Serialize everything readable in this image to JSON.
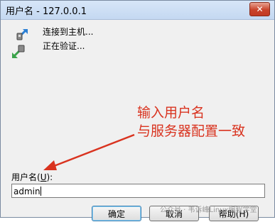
{
  "window": {
    "title": "用户名 - 127.0.0.1",
    "close_glyph": "✕"
  },
  "status": {
    "lines": [
      "连接到主机...",
      "正在验证..."
    ],
    "icon": "connection-icon"
  },
  "annotation": {
    "lines": [
      "输入用户名",
      "与服务器配置一致"
    ],
    "color": "#d9331f"
  },
  "form": {
    "username_label": "用户名(",
    "username_hotkey": "U",
    "username_label_tail": "):",
    "username_value": "admin"
  },
  "buttons": {
    "ok": "确定",
    "cancel": "取消",
    "help": "帮助(H)"
  },
  "watermark": "公众号 · 韦诉峰Linux编程学堂"
}
